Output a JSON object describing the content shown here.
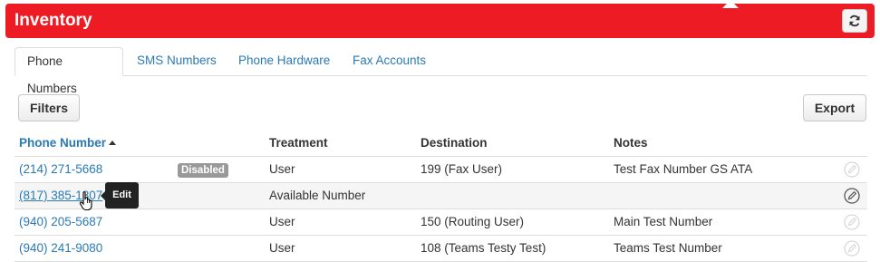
{
  "header": {
    "title": "Inventory",
    "refresh_icon": "refresh-icon"
  },
  "tabs": [
    {
      "label": "Phone Numbers",
      "active": true
    },
    {
      "label": "SMS Numbers",
      "active": false
    },
    {
      "label": "Phone Hardware",
      "active": false
    },
    {
      "label": "Fax Accounts",
      "active": false
    }
  ],
  "toolbar": {
    "filters_label": "Filters",
    "export_label": "Export"
  },
  "table": {
    "columns": [
      "Phone Number",
      "Treatment",
      "Destination",
      "Notes"
    ],
    "sorted_column": "Phone Number",
    "sort_direction": "ascending",
    "rows": [
      {
        "phone": "(214) 271-5668",
        "badge": "Disabled",
        "treatment": "User",
        "destination": "199 (Fax User)",
        "notes": "Test Fax Number GS ATA"
      },
      {
        "phone": "(817) 385-1807",
        "badge": "",
        "treatment": "Available Number",
        "destination": "",
        "notes": ""
      },
      {
        "phone": "(940) 205-5687",
        "badge": "",
        "treatment": "User",
        "destination": "150 (Routing User)",
        "notes": "Main Test Number"
      },
      {
        "phone": "(940) 241-9080",
        "badge": "",
        "treatment": "User",
        "destination": "108 (Teams Testy Test)",
        "notes": "Teams Test Number"
      }
    ]
  },
  "tooltip": {
    "text": "Edit"
  },
  "colors": {
    "brand": "#ed1c24",
    "link": "#2a7ab5",
    "badge": "#999999"
  }
}
